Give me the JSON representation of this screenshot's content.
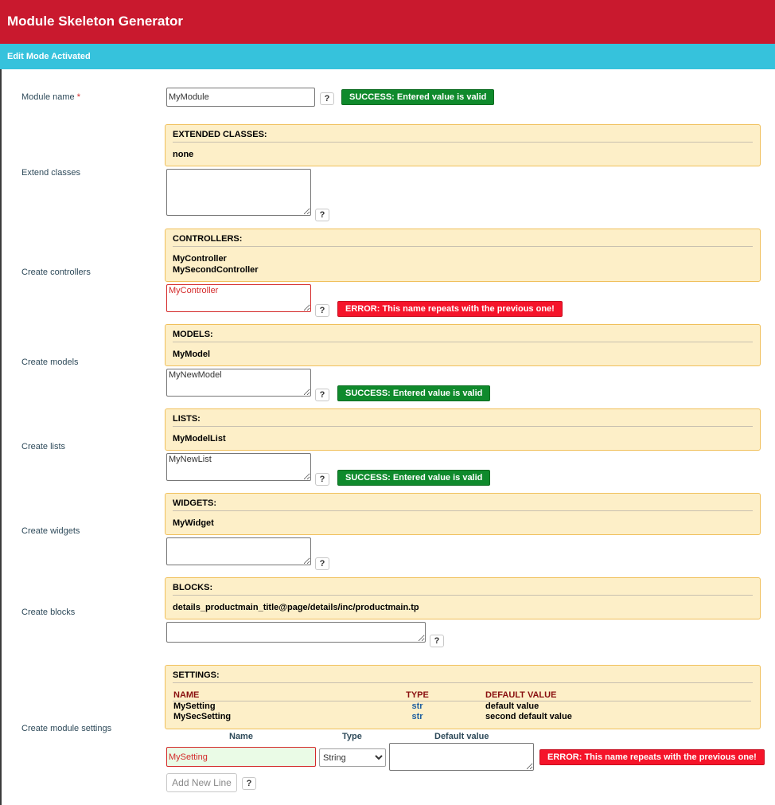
{
  "header": {
    "title": "Module Skeleton Generator"
  },
  "notice": {
    "text": "Edit Mode Activated"
  },
  "help_label": "?",
  "module_name": {
    "label": "Module name",
    "required_mark": "*",
    "value": "MyModule",
    "status": "SUCCESS: Entered value is valid"
  },
  "extend_classes": {
    "label": "Extend classes",
    "box_title": "EXTENDED CLASSES:",
    "items": [
      "none"
    ],
    "input_value": ""
  },
  "controllers": {
    "label": "Create controllers",
    "box_title": "CONTROLLERS:",
    "items": [
      "MyController",
      "MySecondController"
    ],
    "input_value": "MyController",
    "status": "ERROR: This name repeats with the previous one!"
  },
  "models": {
    "label": "Create models",
    "box_title": "MODELS:",
    "items": [
      "MyModel"
    ],
    "input_value": "MyNewModel",
    "status": "SUCCESS: Entered value is valid"
  },
  "lists": {
    "label": "Create lists",
    "box_title": "LISTS:",
    "items": [
      "MyModelList"
    ],
    "input_value": "MyNewList",
    "status": "SUCCESS: Entered value is valid"
  },
  "widgets": {
    "label": "Create widgets",
    "box_title": "WIDGETS:",
    "items": [
      "MyWidget"
    ],
    "input_value": ""
  },
  "blocks": {
    "label": "Create blocks",
    "box_title": "BLOCKS:",
    "items": [
      "details_productmain_title@page/details/inc/productmain.tp"
    ],
    "input_value": ""
  },
  "settings": {
    "label": "Create module settings",
    "box_title": "SETTINGS:",
    "columns": [
      "NAME",
      "TYPE",
      "DEFAULT VALUE"
    ],
    "rows": [
      {
        "name": "MySetting",
        "type": "str",
        "default": "default value"
      },
      {
        "name": "MySecSetting",
        "type": "str",
        "default": "second default value"
      }
    ],
    "form_headers": {
      "name": "Name",
      "type": "Type",
      "default": "Default value"
    },
    "name_value": "MySetting",
    "type_selected": "String",
    "default_value": "",
    "status": "ERROR: This name repeats with the previous one!",
    "add_button": "Add New Line"
  },
  "colors": {
    "header_bg": "#c9192e",
    "notice_bg": "#36c2dc",
    "success": "#0f8a2c",
    "error": "#f5142a",
    "box_bg": "#fdefc8"
  }
}
